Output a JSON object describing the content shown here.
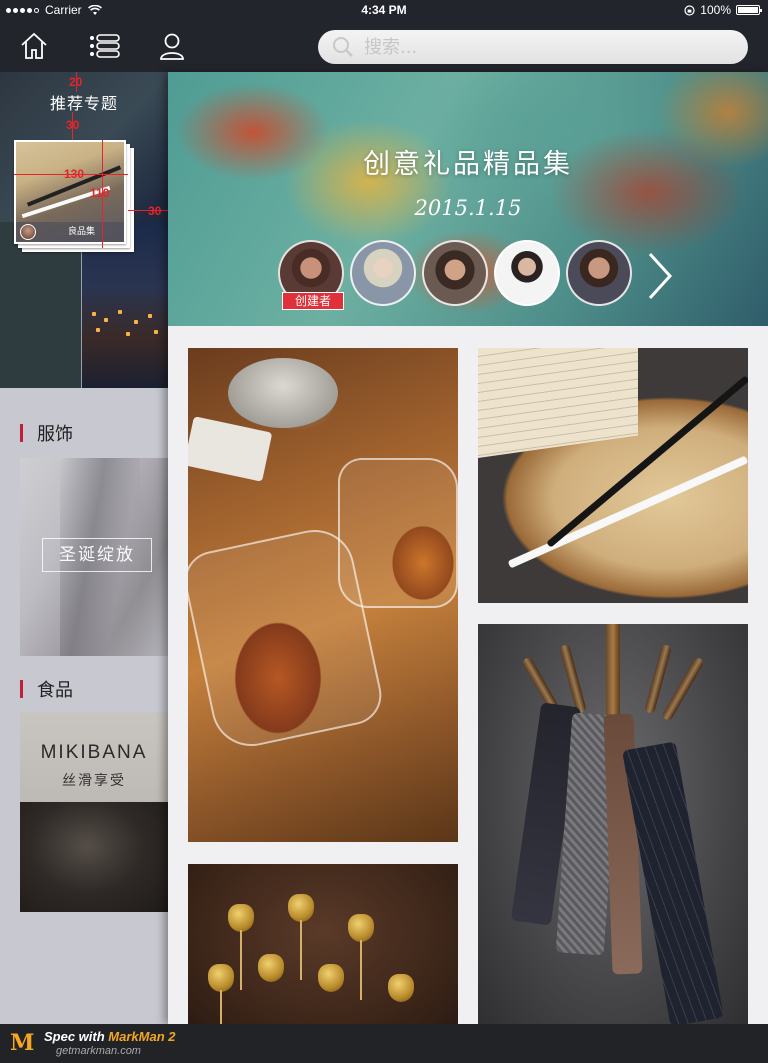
{
  "status_bar": {
    "carrier": "Carrier",
    "time": "4:34 PM",
    "battery": "100%"
  },
  "nav": {
    "icons": [
      "home-icon",
      "list-icon",
      "user-icon"
    ],
    "search_placeholder": "搜索..."
  },
  "sidebar": {
    "section_title": "推荐专题",
    "featured_label": "良品集",
    "spec_marks": [
      "20",
      "30",
      "130",
      "110",
      "30"
    ],
    "categories": [
      {
        "title": "服饰",
        "card_text": "圣诞绽放"
      },
      {
        "title": "食品",
        "card_brand": "MIKIBANA",
        "card_sub": "丝滑享受"
      }
    ]
  },
  "hero": {
    "title": "创意礼品精品集",
    "date": "2015.1.15",
    "creator_badge": "创建者"
  },
  "footer": {
    "spec_prefix": "Spec with ",
    "spec_brand": "MarkMan 2",
    "url": "getmarkman.com"
  },
  "colors": {
    "accent_red": "#e0313b",
    "category_bar": "#c01e3a",
    "nav_bg": "#23252c"
  }
}
